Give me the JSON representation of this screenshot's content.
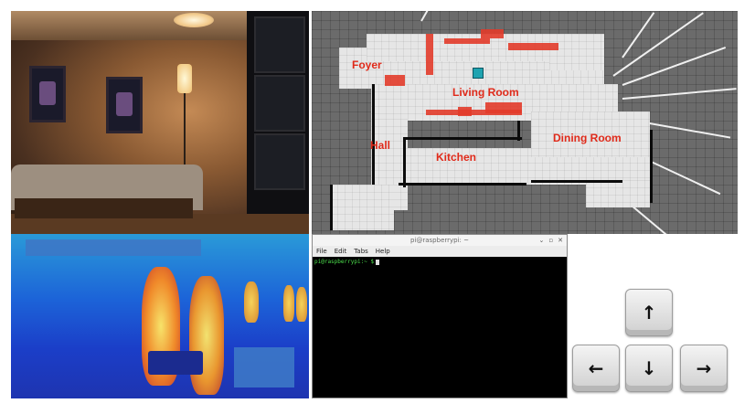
{
  "map": {
    "labels": {
      "foyer": "Foyer",
      "living_room": "Living Room",
      "hall": "Hall",
      "kitchen": "Kitchen",
      "dining_room": "Dining Room"
    }
  },
  "terminal": {
    "title": "pi@raspberrypi: ~",
    "controls": [
      "⌄",
      "▫",
      "✕"
    ],
    "menu": [
      "File",
      "Edit",
      "Tabs",
      "Help"
    ],
    "prompt": "pi@raspberrypi:~ $"
  },
  "keys": {
    "up": "↑",
    "left": "←",
    "down": "↓",
    "right": "→"
  }
}
